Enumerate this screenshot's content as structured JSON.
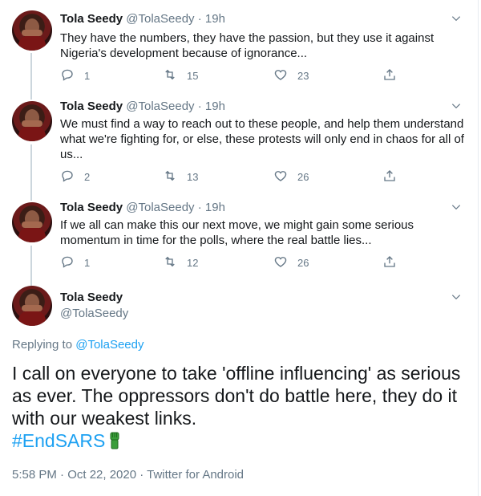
{
  "thread": [
    {
      "name": "Tola Seedy",
      "handle": "@TolaSeedy",
      "separator": "·",
      "time": "19h",
      "text": "They have the numbers, they have the passion, but they use it against Nigeria's development because of ignorance...",
      "replies": "1",
      "retweets": "15",
      "likes": "23"
    },
    {
      "name": "Tola Seedy",
      "handle": "@TolaSeedy",
      "separator": "·",
      "time": "19h",
      "text": "We must find a way to reach out to these people, and help them understand what we're fighting for, or else, these protests will only end in chaos for all of us...",
      "replies": "2",
      "retweets": "13",
      "likes": "26"
    },
    {
      "name": "Tola Seedy",
      "handle": "@TolaSeedy",
      "separator": "·",
      "time": "19h",
      "text": "If we all can make this our next move, we might gain some serious momentum in time for the polls, where the real battle lies...",
      "replies": "1",
      "retweets": "12",
      "likes": "26"
    }
  ],
  "main_tweet": {
    "name": "Tola Seedy",
    "handle": "@TolaSeedy",
    "replying_prefix": "Replying to",
    "replying_to": "@TolaSeedy",
    "text": "I call on everyone to take 'offline influencing' as serious as ever. The oppressors don't do battle here, they do it with our weakest links.",
    "hashtag": "#EndSARS",
    "emoji": "raised-fist-green",
    "timestamp": "5:58 PM · Oct 22, 2020 · Twitter for Android"
  },
  "colors": {
    "link": "#1da1f2",
    "muted": "#657786",
    "text": "#14171a",
    "divider": "#e6ecf0"
  }
}
